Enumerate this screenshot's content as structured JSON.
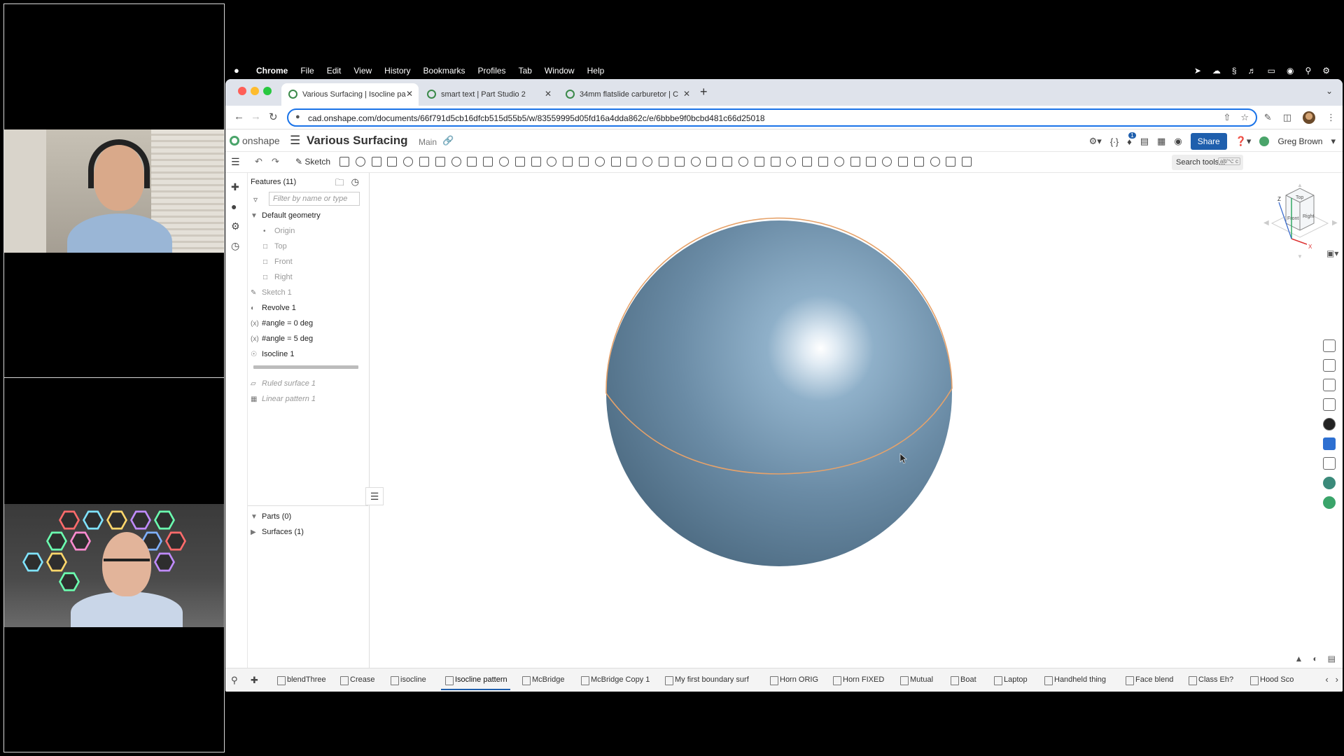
{
  "menubar": {
    "apple": "",
    "items": [
      "Chrome",
      "File",
      "Edit",
      "View",
      "History",
      "Bookmarks",
      "Profiles",
      "Tab",
      "Window",
      "Help"
    ]
  },
  "browser": {
    "tabs": [
      {
        "title": "Various Surfacing | Isocline pa",
        "active": true
      },
      {
        "title": "smart text | Part Studio 2",
        "active": false
      },
      {
        "title": "34mm flatslide carburetor | C",
        "active": false
      }
    ],
    "new_tab": "+",
    "url": "cad.onshape.com/documents/66f791d5cb16dfcb515d55b5/w/83559995d05fd16a4dda862c/e/6bbbe9f0bcbd481c66d25018"
  },
  "onshape": {
    "logo": "onshape",
    "doc_title": "Various Surfacing",
    "branch": "Main",
    "share_label": "Share",
    "notification_count": "1",
    "user": "Greg Brown",
    "sketch_label": "Sketch",
    "search_tools": "Search tools...",
    "search_shortcut": "alt/⌥ c"
  },
  "features": {
    "title": "Features (11)",
    "filter_placeholder": "Filter by name or type",
    "default_geometry": "Default geometry",
    "origin": "Origin",
    "planes": [
      "Top",
      "Front",
      "Right"
    ],
    "items": [
      "Sketch 1",
      "Revolve 1",
      "#angle = 0 deg",
      "#angle = 5 deg",
      "Isocline 1"
    ],
    "rolled_back": [
      "Ruled surface 1",
      "Linear pattern 1"
    ],
    "parts": "Parts (0)",
    "surfaces": "Surfaces (1)"
  },
  "viewcube": {
    "top": "Top",
    "front": "Front",
    "right": "Right",
    "z": "Z",
    "x": "X"
  },
  "bottom_tabs": [
    "blendThree",
    "Crease",
    "isocline",
    "Isocline pattern",
    "McBridge",
    "McBridge Copy 1",
    "My first boundary surf",
    "Horn ORIG",
    "Horn FIXED",
    "Mutual",
    "Boat",
    "Laptop",
    "Handheld thing",
    "Face blend",
    "Class Eh?",
    "Hood Sco"
  ],
  "active_bottom_tab": "Isocline pattern",
  "colors": {
    "accent": "#1f5fad",
    "sphere": "#6f93b0",
    "isocline": "#e6a26a"
  }
}
